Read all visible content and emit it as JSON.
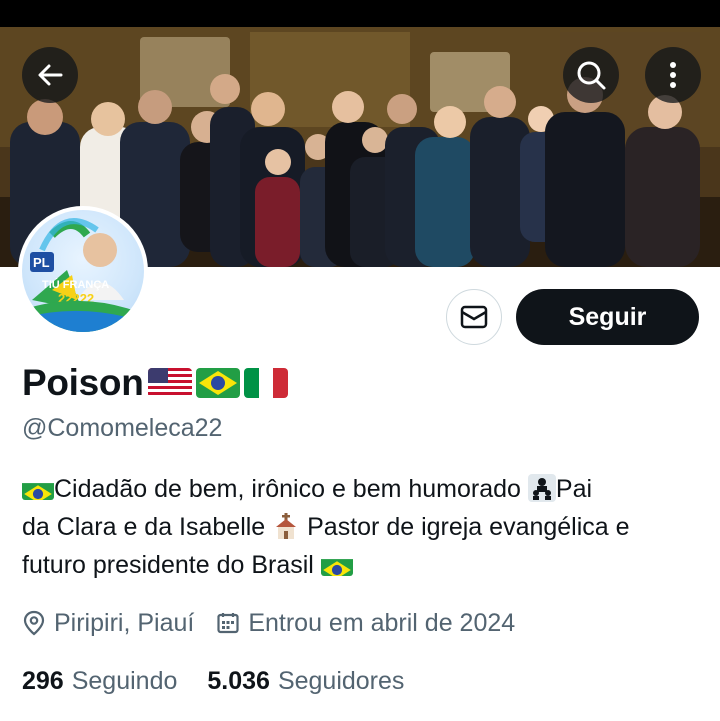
{
  "profile": {
    "display_name": "Poison",
    "name_flags": [
      "flag-usa",
      "flag-brazil",
      "flag-italy"
    ],
    "handle": "@Comomeleca22",
    "bio_parts": {
      "p1": "Cidadão de bem, irônico e bem humorado ",
      "p2": "Pai",
      "p3": "da Clara e da Isabelle ",
      "p4": " Pastor de igreja evangélica e",
      "p5": "futuro presidente do Brasil "
    },
    "location": "Piripiri, Piauí",
    "joined": "Entrou em abril de 2024",
    "following_count": "296",
    "following_label": "Seguindo",
    "followers_count": "5.036",
    "followers_label": "Seguidores"
  },
  "actions": {
    "follow_label": "Seguir"
  },
  "avatar": {
    "badge_text": "PL",
    "name_text": "TIÚ FRANÇA",
    "number_text": "22222"
  },
  "colors": {
    "accent_dark": "#0f1419",
    "secondary_text": "#536471",
    "border": "#cfd9de"
  },
  "icons": {
    "back": "arrow-left-icon",
    "search": "search-icon",
    "more": "more-vertical-icon",
    "message": "mail-icon",
    "location": "location-pin-icon",
    "joined": "calendar-icon"
  }
}
